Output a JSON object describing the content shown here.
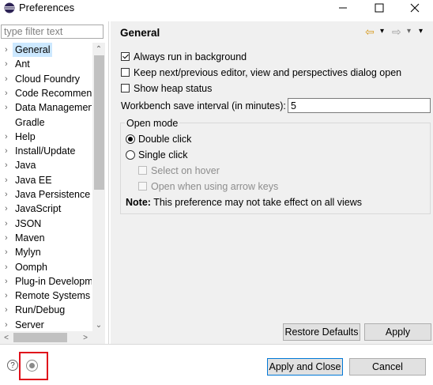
{
  "window": {
    "title": "Preferences",
    "controls": {
      "minimize": "—",
      "maximize": "☐",
      "close": "✕"
    }
  },
  "filter": {
    "placeholder": "type filter text",
    "value": ""
  },
  "tree": {
    "items": [
      {
        "label": "General",
        "arrow": "›",
        "selected": true
      },
      {
        "label": "Ant",
        "arrow": "›"
      },
      {
        "label": "Cloud Foundry",
        "arrow": "›"
      },
      {
        "label": "Code Recommend",
        "arrow": "›"
      },
      {
        "label": "Data Managemen",
        "arrow": "›"
      },
      {
        "label": "Gradle",
        "arrow": ""
      },
      {
        "label": "Help",
        "arrow": "›"
      },
      {
        "label": "Install/Update",
        "arrow": "›"
      },
      {
        "label": "Java",
        "arrow": "›"
      },
      {
        "label": "Java EE",
        "arrow": "›"
      },
      {
        "label": "Java Persistence",
        "arrow": "›"
      },
      {
        "label": "JavaScript",
        "arrow": "›"
      },
      {
        "label": "JSON",
        "arrow": "›"
      },
      {
        "label": "Maven",
        "arrow": "›"
      },
      {
        "label": "Mylyn",
        "arrow": "›"
      },
      {
        "label": "Oomph",
        "arrow": "›"
      },
      {
        "label": "Plug-in Developm",
        "arrow": "›"
      },
      {
        "label": "Remote Systems",
        "arrow": "›"
      },
      {
        "label": "Run/Debug",
        "arrow": "›"
      },
      {
        "label": "Server",
        "arrow": "›"
      }
    ],
    "scroll": {
      "up": "⌃",
      "down": "⌄",
      "left": "<",
      "right": ">"
    }
  },
  "page": {
    "title": "General",
    "nav": {
      "back": "⇦",
      "back_menu": "▾",
      "forward": "⇨",
      "forward_menu": "▾",
      "view_menu": "▾"
    },
    "options": {
      "always_run_background": {
        "label": "Always run in background",
        "checked": true
      },
      "keep_next_prev": {
        "label": "Keep next/previous editor, view and perspectives dialog open",
        "checked": false
      },
      "show_heap_status": {
        "label": "Show heap status",
        "checked": false
      }
    },
    "workbench_save_interval": {
      "label": "Workbench save interval (in minutes):",
      "value": "5"
    },
    "open_mode": {
      "legend": "Open mode",
      "double_click": "Double click",
      "single_click": "Single click",
      "selected": "double_click",
      "select_on_hover": "Select on hover",
      "open_arrow_keys": "Open when using arrow keys",
      "note_label": "Note:",
      "note_text": " This preference may not take effect on all views"
    },
    "buttons": {
      "restore_defaults": "Restore Defaults",
      "apply": "Apply"
    }
  },
  "footer": {
    "help": "?",
    "apply_and_close": "Apply and Close",
    "cancel": "Cancel"
  },
  "colors": {
    "selection": "#cce8ff",
    "panel_bg": "#f0f0f0",
    "highlight_border": "#e0101b",
    "default_button_border": "#0078d7"
  }
}
